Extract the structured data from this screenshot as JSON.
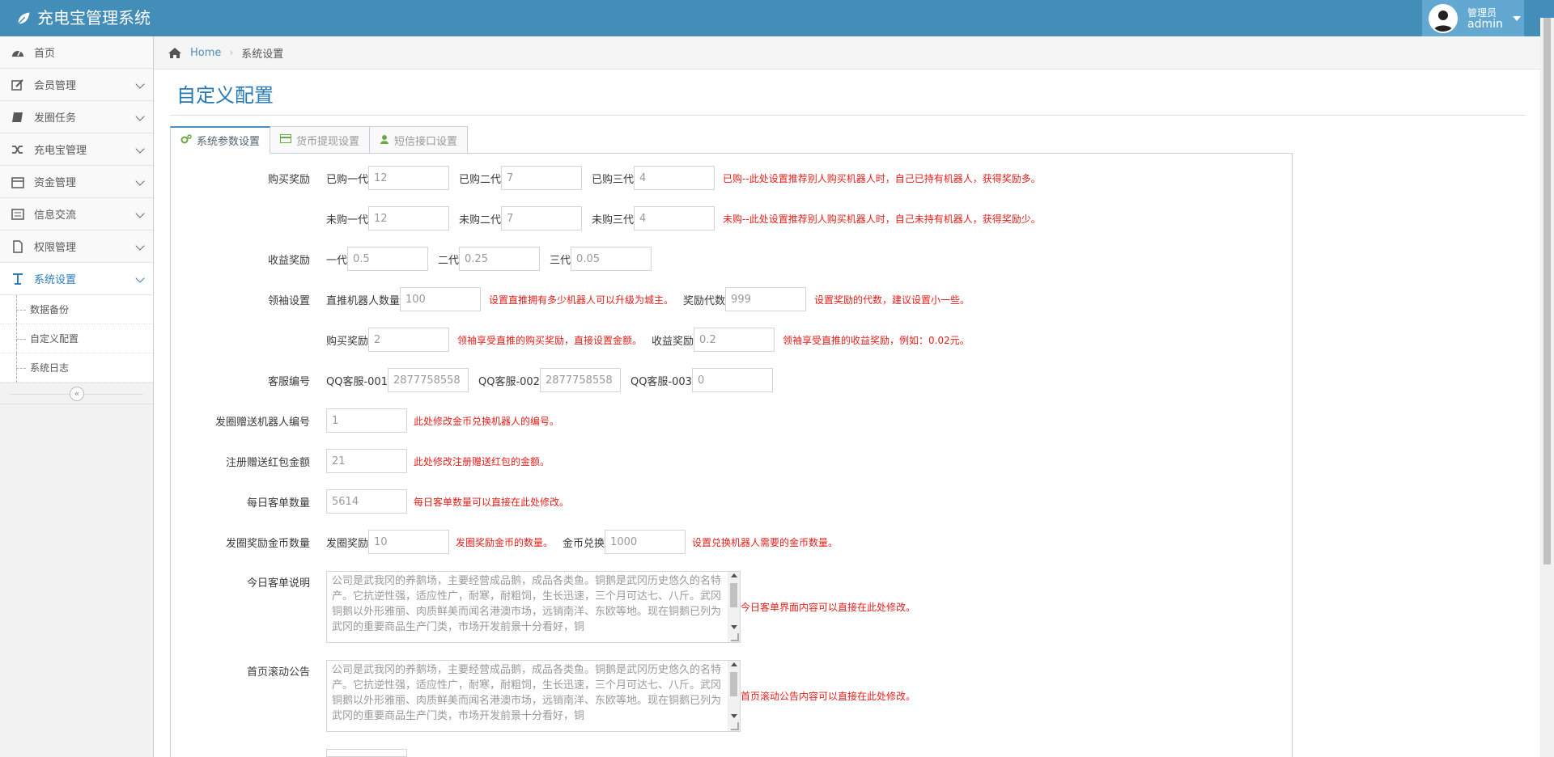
{
  "app": {
    "title": "充电宝管理系统"
  },
  "user": {
    "role": "管理员",
    "name": "admin"
  },
  "sidebar": {
    "items": [
      {
        "label": "首页",
        "icon": "dashboard-icon"
      },
      {
        "label": "会员管理",
        "icon": "edit-icon"
      },
      {
        "label": "发圈任务",
        "icon": "book-icon"
      },
      {
        "label": "充电宝管理",
        "icon": "shuffle-icon"
      },
      {
        "label": "资金管理",
        "icon": "calendar-icon"
      },
      {
        "label": "信息交流",
        "icon": "list-icon"
      },
      {
        "label": "权限管理",
        "icon": "file-icon"
      },
      {
        "label": "系统设置",
        "icon": "text-icon"
      }
    ],
    "sub_items": [
      "数据备份",
      "自定义配置",
      "系统日志"
    ]
  },
  "breadcrumb": {
    "home": "Home",
    "current": "系统设置"
  },
  "page": {
    "title": "自定义配置"
  },
  "tabs": [
    {
      "label": "系统参数设置",
      "icon": "cogs-icon"
    },
    {
      "label": "货币提现设置",
      "icon": "credit-card-icon"
    },
    {
      "label": "短信接口设置",
      "icon": "user-icon"
    }
  ],
  "form": {
    "purchase_reward": {
      "label": "购买奖励",
      "bought": {
        "l1": "已购一代",
        "v1": "12",
        "l2": "已购二代",
        "v2": "7",
        "l3": "已购三代",
        "v3": "4",
        "help": "已购--此处设置推荐别人购买机器人时，自己已持有机器人，获得奖励多。"
      },
      "unbought": {
        "l1": "未购一代",
        "v1": "12",
        "l2": "未购二代",
        "v2": "7",
        "l3": "未购三代",
        "v3": "4",
        "help": "未购--此处设置推荐别人购买机器人时，自己未持有机器人，获得奖励少。"
      }
    },
    "income_reward": {
      "label": "收益奖励",
      "l1": "一代",
      "v1": "0.5",
      "l2": "二代",
      "v2": "0.25",
      "l3": "三代",
      "v3": "0.05"
    },
    "leader": {
      "label": "领袖设置",
      "l1": "直推机器人数量",
      "v1": "100",
      "h1": "设置直推拥有多少机器人可以升级为城主。",
      "l2": "奖励代数",
      "v2": "999",
      "h2": "设置奖励的代数，建议设置小一些。",
      "l3": "购买奖励",
      "v3": "2",
      "h3": "领袖享受直推的购买奖励，直接设置金额。",
      "l4": "收益奖励",
      "v4": "0.2",
      "h4": "领袖享受直推的收益奖励，例如：0.02元。"
    },
    "service": {
      "label": "客服编号",
      "l1": "QQ客服-001",
      "v1": "2877758558",
      "l2": "QQ客服-002",
      "v2": "2877758558",
      "l3": "QQ客服-003",
      "v3": "0"
    },
    "gift_robot": {
      "label": "发圈赠送机器人编号",
      "value": "1",
      "help": "此处修改金币兑换机器人的编号。"
    },
    "register_bonus": {
      "label": "注册赠送红包金额",
      "value": "21",
      "help": "此处修改注册赠送红包的金额。"
    },
    "daily_orders": {
      "label": "每日客单数量",
      "value": "5614",
      "help": "每日客单数量可以直接在此处修改。"
    },
    "coin_reward": {
      "label": "发圈奖励金币数量",
      "l1": "发圈奖励",
      "v1": "10",
      "h1": "发圈奖励金币的数量。",
      "l2": "金币兑换",
      "v2": "1000",
      "h2": "设置兑换机器人需要的金币数量。"
    },
    "today_desc": {
      "label": "今日客单说明",
      "text": "公司是武我冈的养鹅场，主要经营成品鹅，成品各类鱼。铜鹅是武冈历史悠久的名特产。它抗逆性强，适应性广，耐寒，耐粗饲，生长迅速，三个月可达七、八斤。武冈铜鹅以外形雅丽、肉质鲜美而闻名港澳市场，远销南洋、东欧等地。现在铜鹅已列为武冈的重要商品生产门类，市场开发前景十分看好，铜",
      "help": "今日客单界面内容可以直接在此处修改。"
    },
    "home_notice": {
      "label": "首页滚动公告",
      "text": "公司是武我冈的养鹅场，主要经营成品鹅，成品各类鱼。铜鹅是武冈历史悠久的名特产。它抗逆性强，适应性广，耐寒，耐粗饲，生长迅速，三个月可达七、八斤。武冈铜鹅以外形雅丽、肉质鲜美而闻名港澳市场，远销南洋、东欧等地。现在铜鹅已列为武冈的重要商品生产门类，市场开发前景十分看好，铜",
      "help": "首页滚动公告内容可以直接在此处修改。"
    }
  },
  "colors": {
    "navbar": "#438eb9",
    "accent": "#2679b5",
    "help": "#e4201b"
  }
}
